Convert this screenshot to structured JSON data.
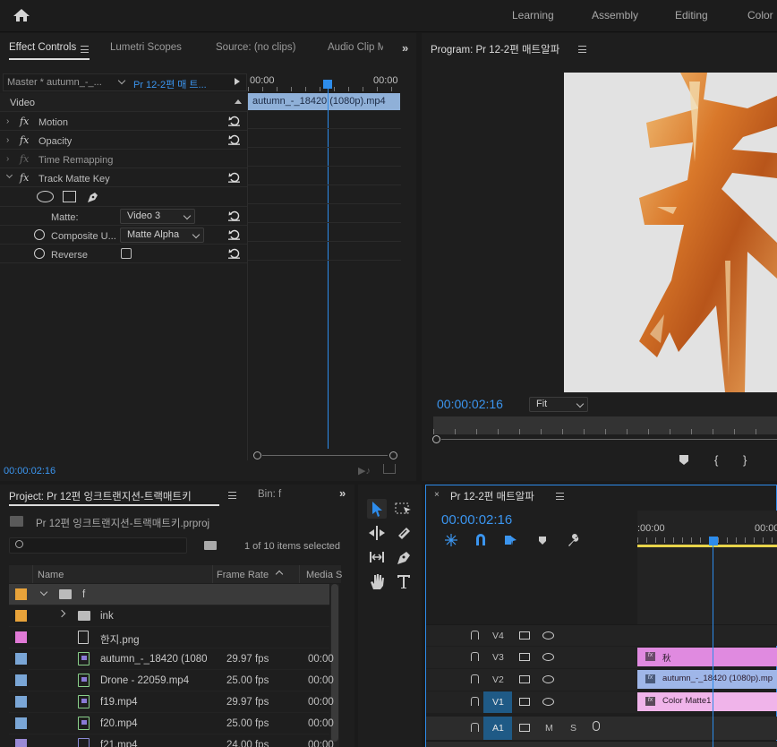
{
  "workspaces": [
    "Learning",
    "Assembly",
    "Editing",
    "Color"
  ],
  "effect_controls": {
    "tabs": [
      "Effect Controls",
      "Lumetri Scopes",
      "Source: (no clips)",
      "Audio Clip M"
    ],
    "master_label": "Master * autumn_-_...",
    "sequence_label": "Pr 12-2편 매 트...",
    "ruler_start": "00:00",
    "ruler_end": "00:00",
    "clip_name": "autumn_-_18420 (1080p).mp4",
    "section_video": "Video",
    "effects": [
      "Motion",
      "Opacity",
      "Time Remapping",
      "Track Matte Key"
    ],
    "matte_label": "Matte:",
    "matte_value": "Video 3",
    "composite_label": "Composite U...",
    "composite_value": "Matte Alpha",
    "reverse_label": "Reverse",
    "timecode": "00:00:02:16"
  },
  "program": {
    "title": "Program: Pr 12-2편 매트알파",
    "timecode": "00:00:02:16",
    "fit": "Fit"
  },
  "project": {
    "tab": "Project: Pr 12편 잉크트랜지션-트랙매트키",
    "bin_tab": "Bin: f",
    "file": "Pr 12편 잉크트랜지션-트랙매트키.prproj",
    "selection": "1 of 10 items selected",
    "columns": {
      "name": "Name",
      "frame_rate": "Frame Rate",
      "media": "Media S"
    },
    "rows": [
      {
        "name": "f",
        "fps": "",
        "media": "",
        "color": "#e8a33a",
        "kind": "folder-open"
      },
      {
        "name": "ink",
        "fps": "",
        "media": "",
        "color": "#e8a33a",
        "kind": "folder"
      },
      {
        "name": "한지.png",
        "fps": "",
        "media": "",
        "color": "#e07ad6",
        "kind": "image"
      },
      {
        "name": "autumn_-_18420 (1080",
        "fps": "29.97 fps",
        "media": "00:00",
        "color": "#7aa6d6",
        "kind": "video"
      },
      {
        "name": "Drone - 22059.mp4",
        "fps": "25.00 fps",
        "media": "00:00",
        "color": "#7aa6d6",
        "kind": "video"
      },
      {
        "name": "f19.mp4",
        "fps": "29.97 fps",
        "media": "00:00",
        "color": "#7aa6d6",
        "kind": "video"
      },
      {
        "name": "f20.mp4",
        "fps": "25.00 fps",
        "media": "00:00",
        "color": "#7aa6d6",
        "kind": "video"
      },
      {
        "name": "f21.mp4",
        "fps": "24.00 fps",
        "media": "00:00",
        "color": "#9a8ad6",
        "kind": "video"
      }
    ]
  },
  "timeline": {
    "title": "Pr 12-2편 매트알파",
    "timecode": "00:00:02:16",
    "ruler_start": ":00:00",
    "ruler_end": "00:00",
    "tracks": [
      "V4",
      "V3",
      "V2",
      "V1",
      "A1"
    ],
    "track_v1_target": "V1",
    "track_a1_target": "A1",
    "mute_label": "M",
    "solo_label": "S",
    "clips": [
      {
        "label": "秋",
        "color": "#e08ae0"
      },
      {
        "label": "autumn_-_18420 (1080p).mp",
        "color": "#9fb6e8"
      },
      {
        "label": "Color Matte1",
        "color": "#f0b4ea"
      }
    ]
  },
  "accent": "#2d8ceb"
}
